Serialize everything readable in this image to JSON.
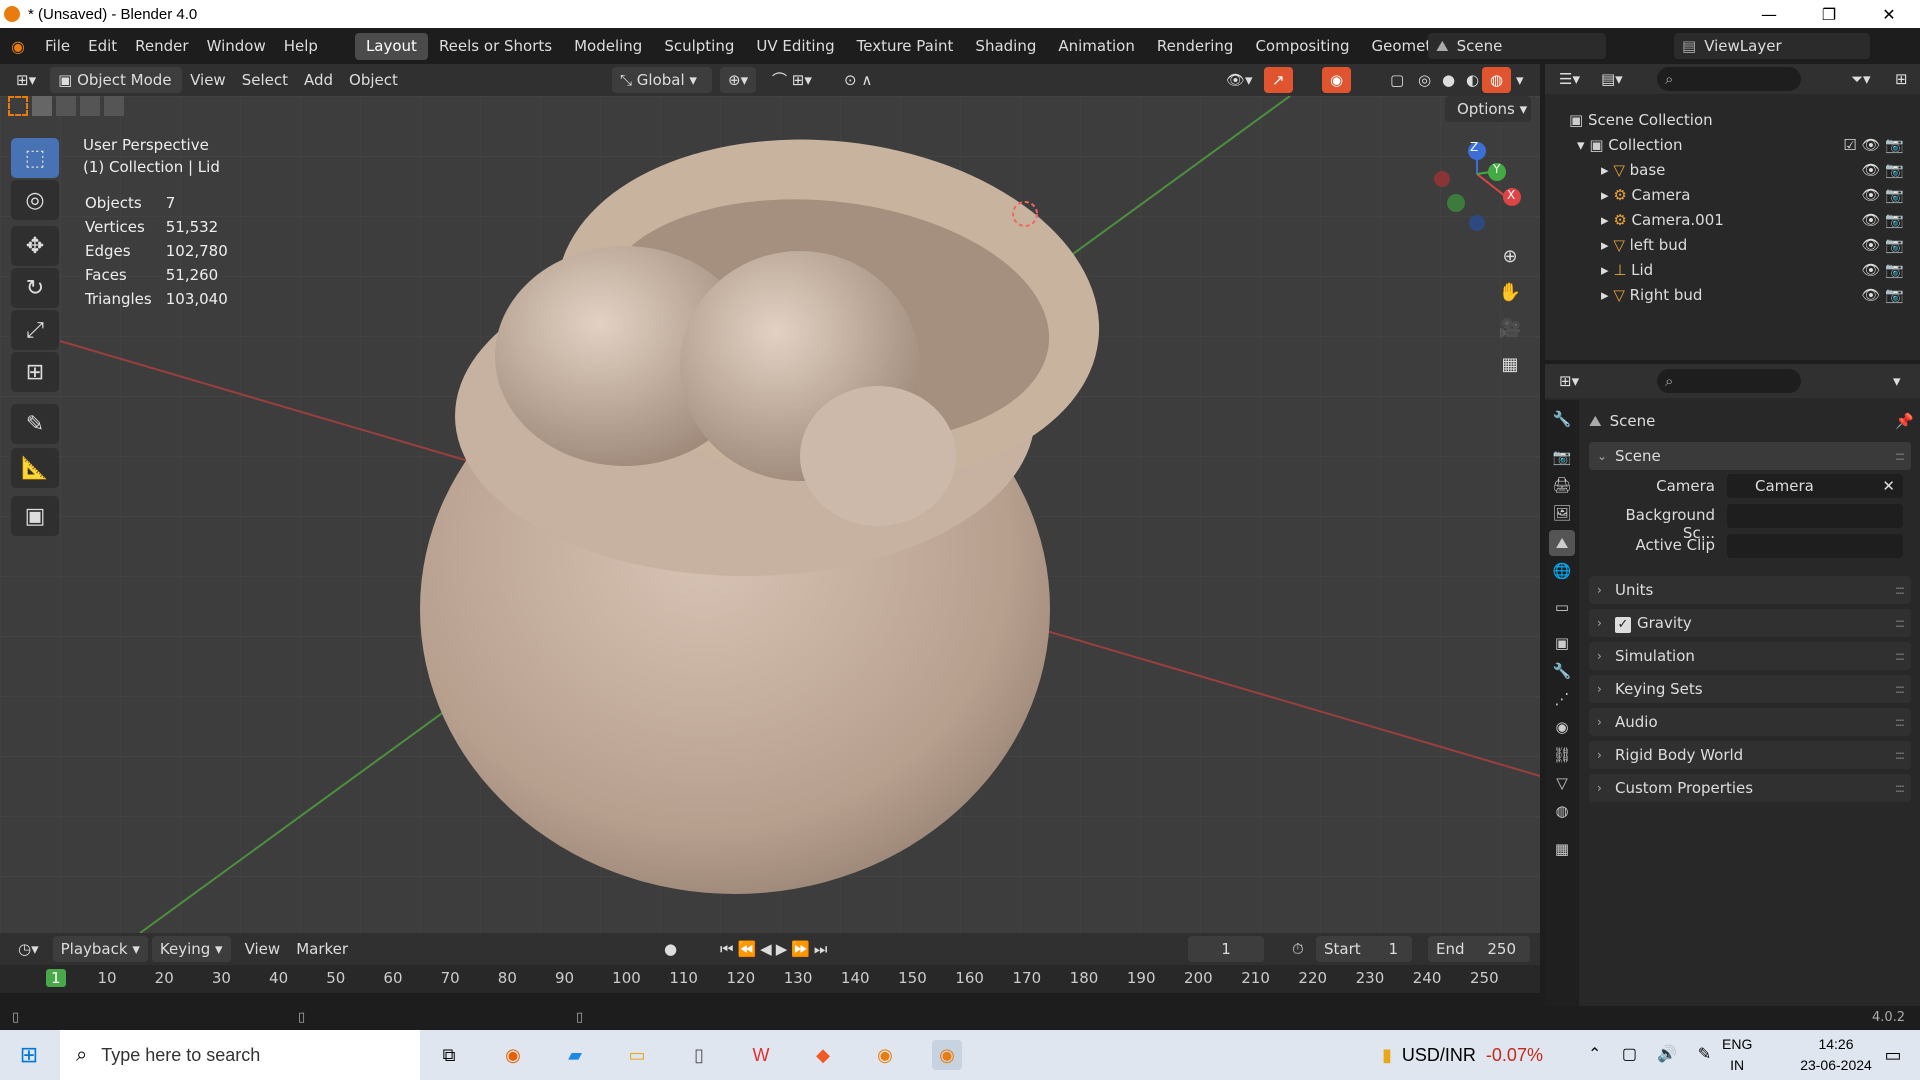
{
  "window": {
    "title": "* (Unsaved) - Blender 4.0",
    "minimize": "—",
    "maximize": "❐",
    "close": "✕"
  },
  "menus": [
    "File",
    "Edit",
    "Render",
    "Window",
    "Help"
  ],
  "workspaces": [
    "Layout",
    "Reels or Shorts",
    "Modeling",
    "Sculpting",
    "UV Editing",
    "Texture Paint",
    "Shading",
    "Animation",
    "Rendering",
    "Compositing",
    "Geometry Nodes"
  ],
  "scene_field": "Scene",
  "viewlayer_field": "ViewLayer",
  "viewport_header": {
    "mode": "Object Mode",
    "view": "View",
    "select": "Select",
    "add": "Add",
    "object": "Object",
    "transform": "Global",
    "options": "Options"
  },
  "overlay": {
    "perspective": "User Perspective",
    "context": "(1) Collection | Lid",
    "stats": [
      {
        "label": "Objects",
        "value": "7"
      },
      {
        "label": "Vertices",
        "value": "51,532"
      },
      {
        "label": "Edges",
        "value": "102,780"
      },
      {
        "label": "Faces",
        "value": "51,260"
      },
      {
        "label": "Triangles",
        "value": "103,040"
      }
    ]
  },
  "gizmo": {
    "x": "X",
    "y": "Y",
    "z": "Z"
  },
  "timeline": {
    "playback": "Playback",
    "keying": "Keying",
    "view": "View",
    "marker": "Marker",
    "current_frame": "1",
    "start_label": "Start",
    "start": "1",
    "end_label": "End",
    "end": "250",
    "ruler": [
      "1",
      "10",
      "20",
      "30",
      "40",
      "50",
      "60",
      "70",
      "80",
      "90",
      "100",
      "110",
      "120",
      "130",
      "140",
      "150",
      "160",
      "170",
      "180",
      "190",
      "200",
      "210",
      "220",
      "230",
      "240",
      "250"
    ]
  },
  "version": "4.0.2",
  "outliner": {
    "scene_collection": "Scene Collection",
    "collection": "Collection",
    "items": [
      {
        "name": "base",
        "color": "#e8a23a"
      },
      {
        "name": "Camera",
        "color": "#e8a23a"
      },
      {
        "name": "Camera.001",
        "color": "#e8a23a"
      },
      {
        "name": "left bud",
        "color": "#e8a23a"
      },
      {
        "name": "Lid",
        "color": "#e8a23a"
      },
      {
        "name": "Right bud",
        "color": "#e8a23a"
      }
    ]
  },
  "properties": {
    "context": "Scene",
    "panel_scene": "Scene",
    "camera_label": "Camera",
    "camera_value": "Camera",
    "bg_label": "Background Sc...",
    "clip_label": "Active Clip",
    "panels": [
      "Units",
      "Gravity",
      "Simulation",
      "Keying Sets",
      "Audio",
      "Rigid Body World",
      "Custom Properties"
    ]
  },
  "taskbar": {
    "search_placeholder": "Type here to search",
    "currency": "USD/INR",
    "change": "-0.07%",
    "lang1": "ENG",
    "lang2": "IN",
    "time": "14:26",
    "date": "23-06-2024"
  },
  "colors": {
    "accent": "#4772b3",
    "active_tab": "#4b4b4b",
    "orange": "#e87d0d",
    "change_red": "#c42b1c"
  }
}
